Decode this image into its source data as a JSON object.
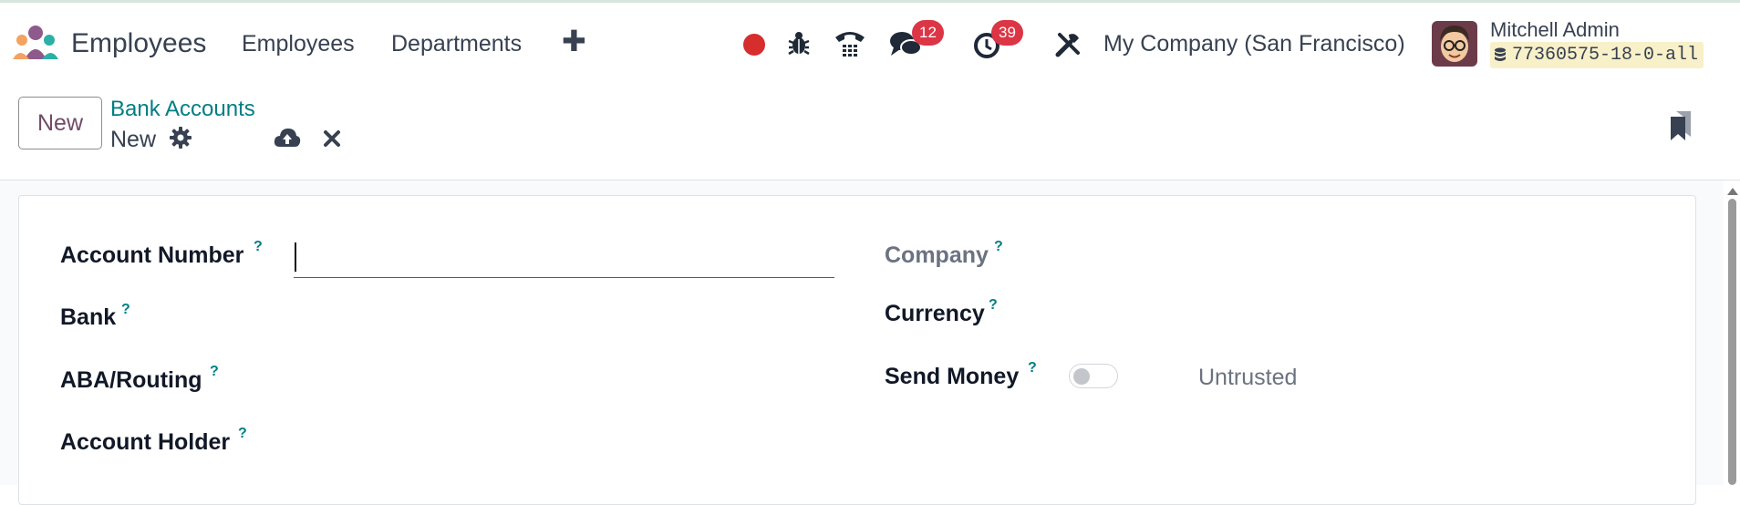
{
  "navbar": {
    "app_name": "Employees",
    "menu": [
      {
        "label": "Employees"
      },
      {
        "label": "Departments"
      }
    ],
    "new_menu_icon": "plus-icon",
    "systray": {
      "recording_color": "#d62d2d",
      "messages_count": "12",
      "activities_count": "39"
    },
    "company": "My Company (San Francisco)",
    "user": {
      "name": "Mitchell Admin",
      "database": "77360575-18-0-all"
    }
  },
  "control_panel": {
    "new_button": "New",
    "breadcrumb": "Bank Accounts",
    "record_name": "New"
  },
  "form": {
    "fields_left": [
      {
        "label": "Account Number",
        "help": "?",
        "value": ""
      },
      {
        "label": "Bank",
        "help": "?"
      },
      {
        "label": "ABA/Routing",
        "help": "?"
      },
      {
        "label": "Account Holder",
        "help": "?"
      }
    ],
    "fields_right": [
      {
        "label": "Company",
        "help": "?"
      },
      {
        "label": "Currency",
        "help": "?"
      },
      {
        "label": "Send Money",
        "help": "?",
        "status": "Untrusted",
        "toggle_on": false
      }
    ]
  },
  "colors": {
    "brand_primary": "#714b67",
    "link_teal": "#017e84",
    "badge_red": "#dc3545"
  }
}
